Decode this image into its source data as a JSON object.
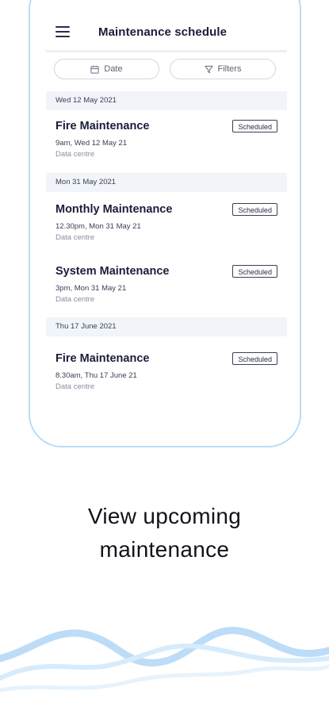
{
  "app": {
    "title": "Maintenance schedule",
    "menu_icon": "hamburger-icon"
  },
  "filters": {
    "date_label": "Date",
    "date_icon": "calendar-icon",
    "filters_label": "Filters",
    "filters_icon": "funnel-icon"
  },
  "sections": [
    {
      "date": "Wed 12 May 2021",
      "items": [
        {
          "title": "Fire Maintenance",
          "time": "9am, Wed 12 May 21",
          "location": "Data centre",
          "status": "Scheduled"
        }
      ]
    },
    {
      "date": "Mon 31 May 2021",
      "items": [
        {
          "title": "Monthly Maintenance",
          "time": "12.30pm, Mon 31 May 21",
          "location": "Data centre",
          "status": "Scheduled"
        },
        {
          "title": "System Maintenance",
          "time": "3pm, Mon 31 May 21",
          "location": "Data centre",
          "status": "Scheduled"
        }
      ]
    },
    {
      "date": "Thu 17 June 2021",
      "items": [
        {
          "title": "Fire Maintenance",
          "time": "8.30am, Thu 17 June 21",
          "location": "Data centre",
          "status": "Scheduled"
        }
      ]
    }
  ],
  "tagline": {
    "line1": "View upcoming",
    "line2": "maintenance"
  },
  "colors": {
    "phone_border": "#b9dcf6",
    "section_header_bg": "#f1f4f9",
    "text_primary": "#1b1d3a",
    "wave_blue": "#bcdcf7"
  }
}
